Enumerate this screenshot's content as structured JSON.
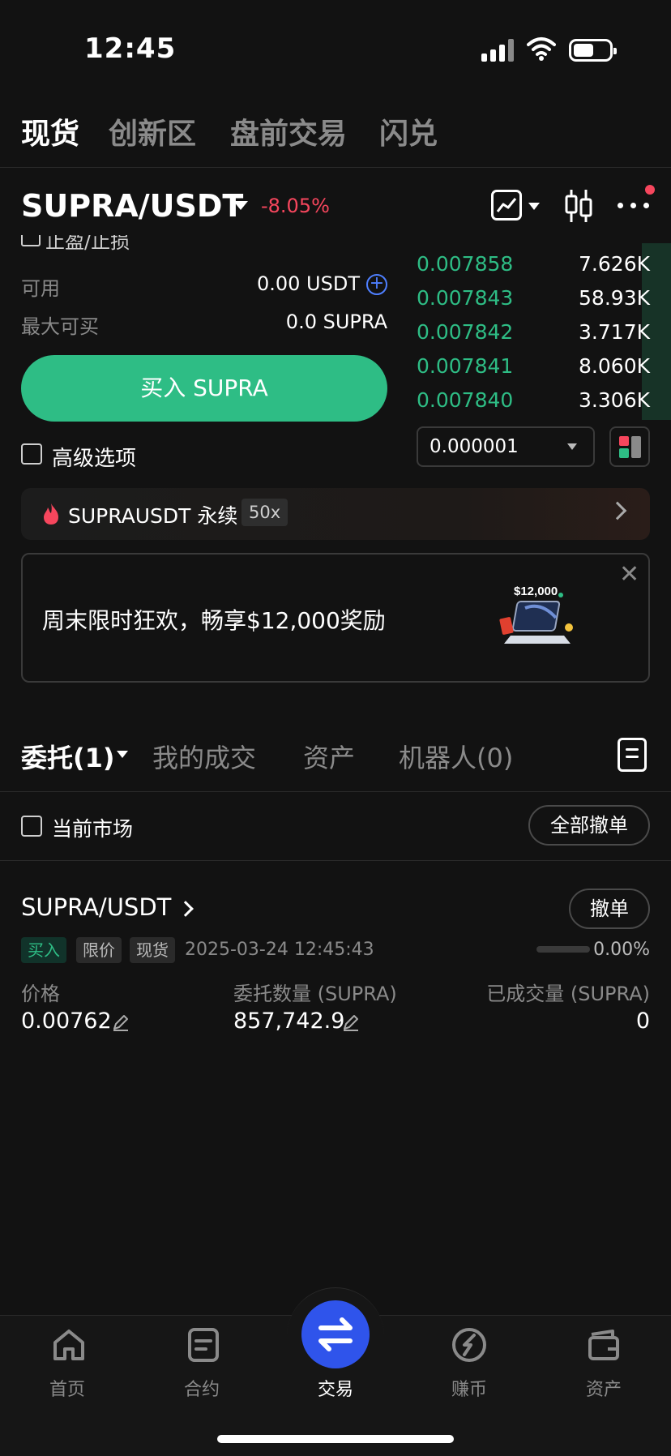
{
  "status_bar": {
    "time": "12:45"
  },
  "top_tabs": [
    "现货",
    "创新区",
    "盘前交易",
    "闪兑"
  ],
  "pair": {
    "symbol": "SUPRA/USDT",
    "change": "-8.05%"
  },
  "form": {
    "cut_label": "止盈/止损",
    "available_label": "可用",
    "available_value": "0.00 USDT",
    "max_buy_label": "最大可买",
    "max_buy_value": "0.0 SUPRA",
    "buy_button": "买入 SUPRA",
    "advanced_label": "高级选项"
  },
  "orderbook": {
    "bids": [
      {
        "price": "0.007858",
        "qty": "7.626K"
      },
      {
        "price": "0.007843",
        "qty": "58.93K"
      },
      {
        "price": "0.007842",
        "qty": "3.717K"
      },
      {
        "price": "0.007841",
        "qty": "8.060K"
      },
      {
        "price": "0.007840",
        "qty": "3.306K"
      }
    ],
    "precision": "0.000001"
  },
  "perp_banner": {
    "label": "SUPRAUSDT 永续",
    "leverage": "50x"
  },
  "promo": {
    "text": "周末限时狂欢，畅享$12,000奖励",
    "graphic_text": "$12,000"
  },
  "order_tabs": [
    "委托(1)",
    "我的成交",
    "资产",
    "机器人(0)"
  ],
  "filter": {
    "current_market_label": "当前市场",
    "cancel_all": "全部撤单"
  },
  "order": {
    "pair": "SUPRA/USDT",
    "cancel": "撤单",
    "tags": [
      "买入",
      "限价",
      "现货"
    ],
    "time": "2025-03-24 12:45:43",
    "filled_pct": "0.00%",
    "filled_fraction": 0,
    "price_label": "价格",
    "price_value": "0.00762",
    "amount_label": "委托数量 (SUPRA)",
    "amount_value": "857,742.9",
    "filled_label": "已成交量 (SUPRA)",
    "filled_value": "0"
  },
  "bottom_nav": [
    {
      "label": "首页",
      "icon": "home-icon"
    },
    {
      "label": "合约",
      "icon": "futures-icon"
    },
    {
      "label": "交易",
      "icon": "trade-swap-icon"
    },
    {
      "label": "赚币",
      "icon": "earn-icon"
    },
    {
      "label": "资产",
      "icon": "wallet-icon"
    }
  ],
  "colors": {
    "background": "#121212",
    "buy_green": "#2ebd85",
    "sell_red": "#f6465d",
    "accent_blue": "#2f54eb"
  }
}
